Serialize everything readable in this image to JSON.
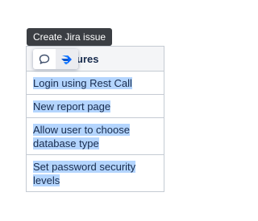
{
  "tooltip": {
    "text": "Create Jira issue"
  },
  "table": {
    "header_visible_text": "ures",
    "rows": [
      {
        "text": "Login using Rest Call"
      },
      {
        "text": "New report page"
      },
      {
        "text": "Allow user to choose database type"
      },
      {
        "text": "Set password security levels"
      }
    ]
  },
  "toolbar": {
    "buttons": [
      {
        "icon": "comment-icon"
      },
      {
        "icon": "jira-issue-icon"
      }
    ]
  },
  "colors": {
    "selection": "#b4d5fe",
    "tooltip_bg": "#3b3e43",
    "border": "#c5cbd3",
    "header_bg": "#f4f5f7",
    "jira_blue": "#2684ff"
  }
}
